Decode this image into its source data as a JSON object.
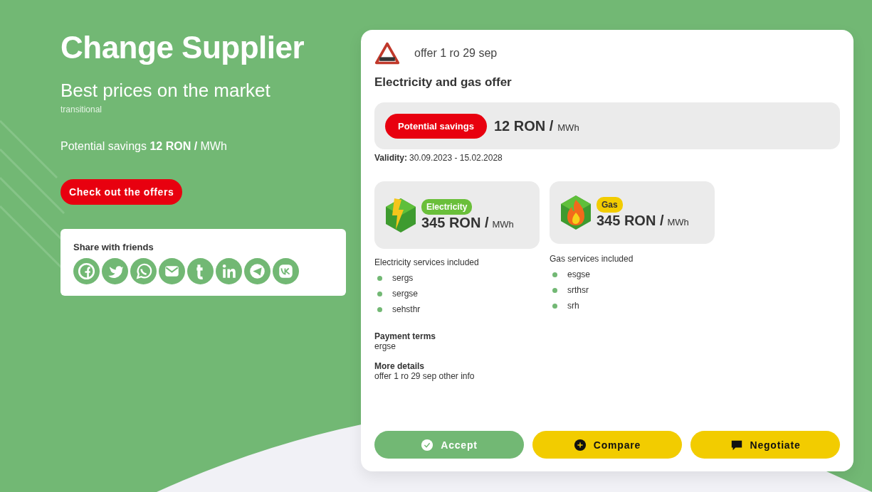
{
  "hero": {
    "title": "Change Supplier",
    "subtitle": "Best prices on the market",
    "tag": "transitional",
    "savings": "Potential savings **12 RON /** MWh",
    "cta": "Check out the offers"
  },
  "share": {
    "title": "Share with friends"
  },
  "offer": {
    "name": "offer 1 ro 29 sep",
    "heading": "Electricity and gas offer",
    "savings_badge": "Potential savings",
    "savings_value": "12 RON /",
    "savings_unit": "MWh",
    "validity_label": "Validity:",
    "validity": "30.09.2023 - 15.02.2028",
    "energies": [
      {
        "kind": "electricity",
        "badge": "Electricity",
        "color": "#6abf3a",
        "price": "345 RON /",
        "unit": "MWh",
        "services_title": "Electricity services included",
        "services": [
          "sergs",
          "sergse",
          "sehsthr"
        ]
      },
      {
        "kind": "gas",
        "badge": "Gas",
        "color": "#f2cc00",
        "price": "345 RON /",
        "unit": "MWh",
        "services_title": "Gas services included",
        "services": [
          "esgse",
          "srthsr",
          "srh"
        ]
      }
    ],
    "payment_title": "Payment terms",
    "payment": "ergse",
    "details_title": "More details",
    "details": "offer 1 ro 29 sep other info",
    "actions": [
      {
        "kind": "accept",
        "label": "Accept"
      },
      {
        "kind": "compare",
        "label": "Compare"
      },
      {
        "kind": "negotiate",
        "label": "Negotiate"
      }
    ]
  }
}
